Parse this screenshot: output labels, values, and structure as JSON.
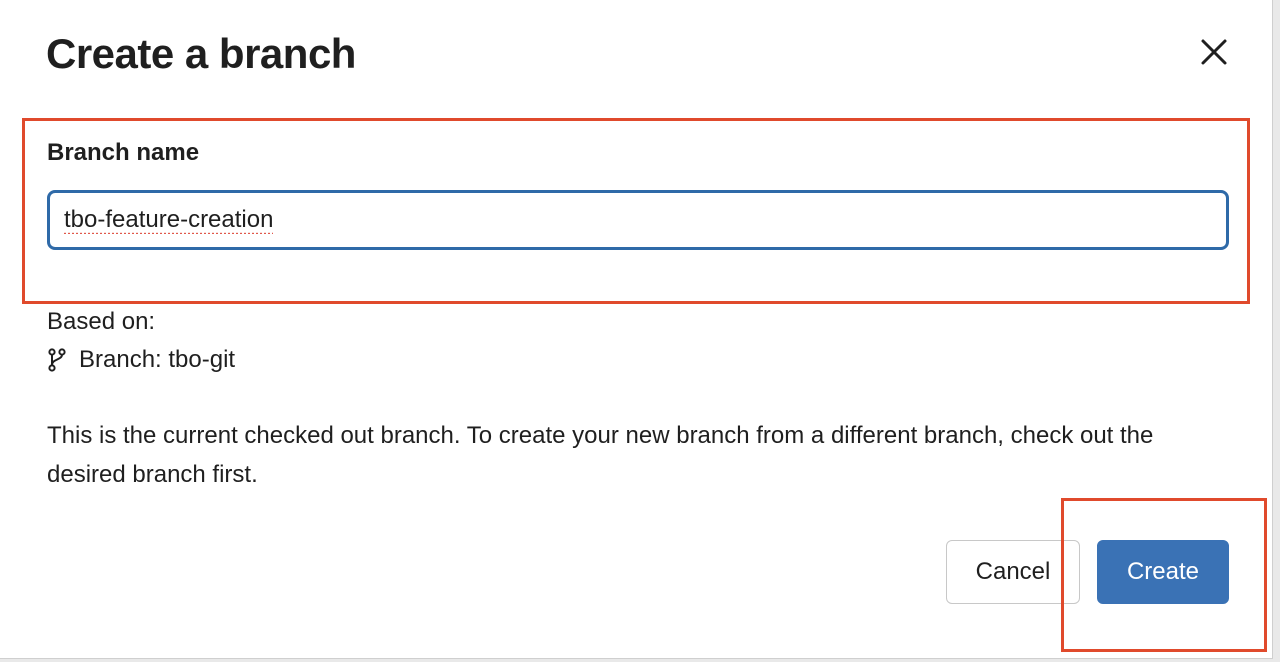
{
  "dialog": {
    "title": "Create a branch",
    "close_icon": "close-icon"
  },
  "form": {
    "branch_name_label": "Branch name",
    "branch_name_value": "tbo-feature-creation"
  },
  "based_on": {
    "label": "Based on:",
    "icon": "git-branch-icon",
    "branch_text": "Branch: tbo-git"
  },
  "description": "This is the current checked out branch. To create your new branch from a different branch, check out the desired branch first.",
  "buttons": {
    "cancel_label": "Cancel",
    "create_label": "Create"
  },
  "colors": {
    "primary": "#3a72b5",
    "input_focus_border": "#2f6aa8",
    "highlight": "#e04a2c"
  }
}
